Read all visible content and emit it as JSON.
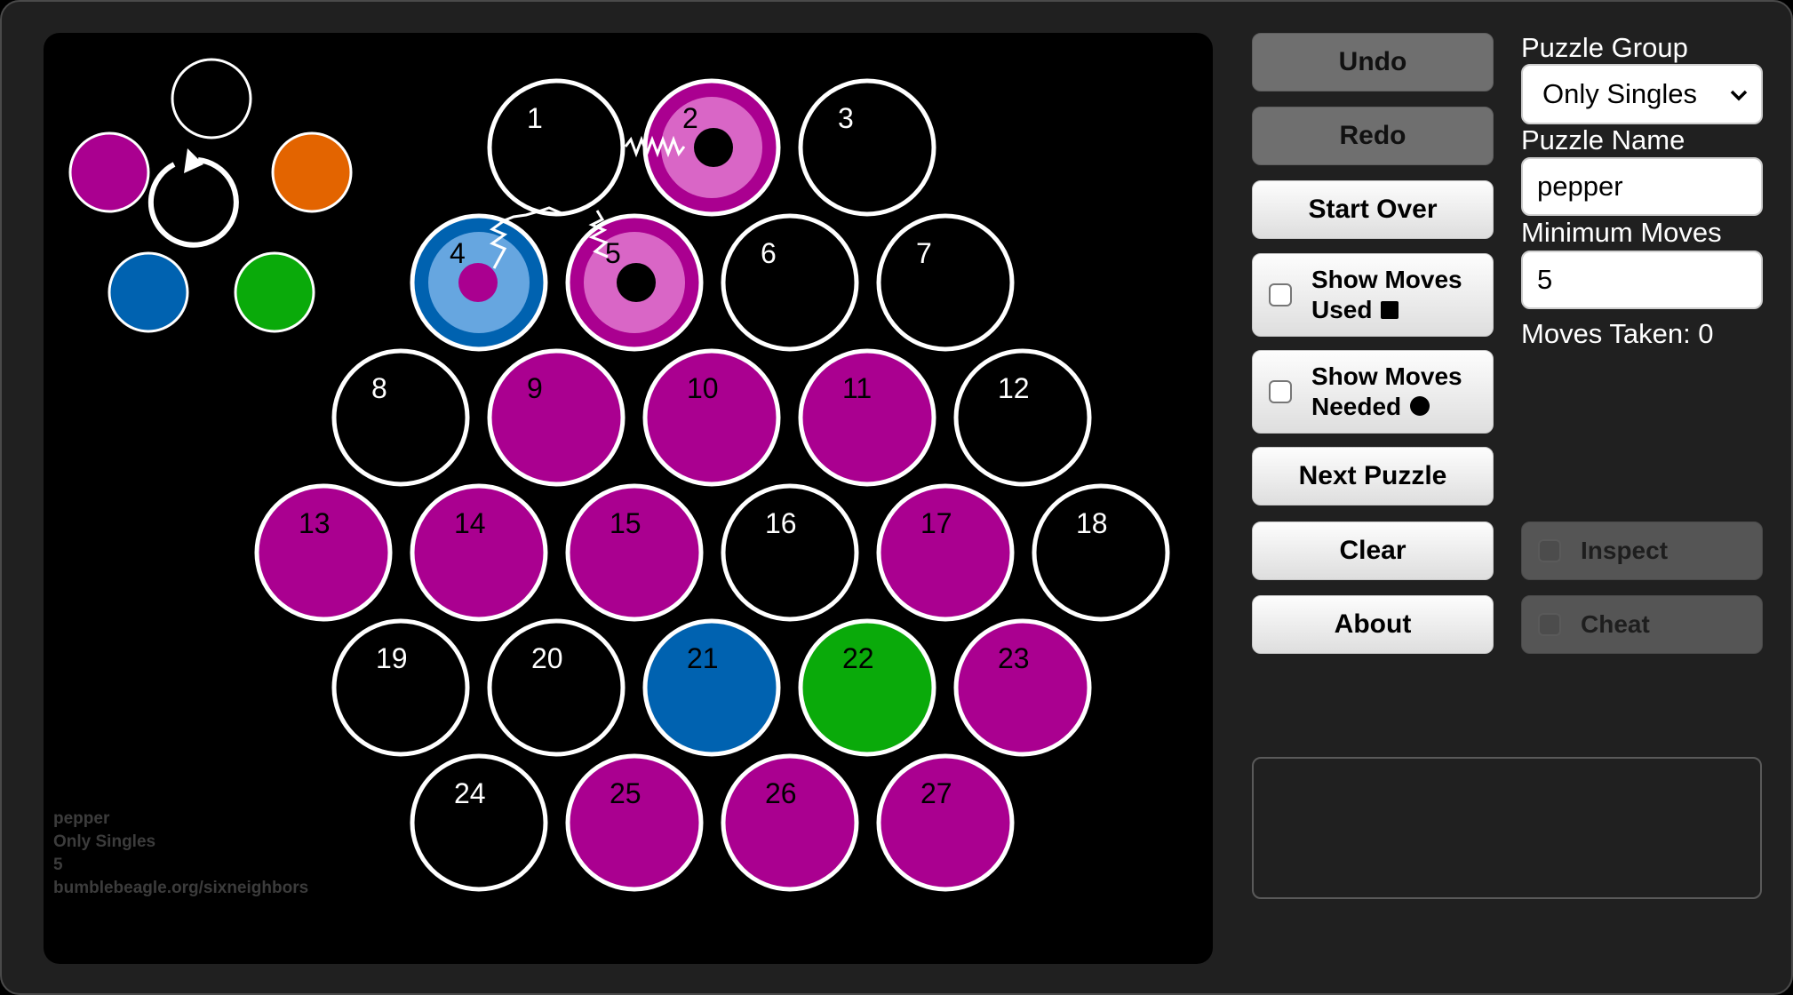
{
  "board": {
    "cells": [
      {
        "n": "1",
        "fill": "#000000",
        "state": "empty"
      },
      {
        "n": "2",
        "fill": "#d966c6",
        "state": "selected-target"
      },
      {
        "n": "3",
        "fill": "#000000",
        "state": "empty"
      },
      {
        "n": "4",
        "fill": "#66a6e0",
        "state": "selected-source"
      },
      {
        "n": "5",
        "fill": "#d966c6",
        "state": "selected-target"
      },
      {
        "n": "6",
        "fill": "#000000",
        "state": "empty"
      },
      {
        "n": "7",
        "fill": "#000000",
        "state": "empty"
      },
      {
        "n": "8",
        "fill": "#000000",
        "state": "empty"
      },
      {
        "n": "9",
        "fill": "#aa0090",
        "state": "magenta"
      },
      {
        "n": "10",
        "fill": "#aa0090",
        "state": "magenta"
      },
      {
        "n": "11",
        "fill": "#aa0090",
        "state": "magenta"
      },
      {
        "n": "12",
        "fill": "#000000",
        "state": "empty"
      },
      {
        "n": "13",
        "fill": "#aa0090",
        "state": "magenta"
      },
      {
        "n": "14",
        "fill": "#aa0090",
        "state": "magenta"
      },
      {
        "n": "15",
        "fill": "#aa0090",
        "state": "magenta"
      },
      {
        "n": "16",
        "fill": "#000000",
        "state": "empty"
      },
      {
        "n": "17",
        "fill": "#aa0090",
        "state": "magenta"
      },
      {
        "n": "18",
        "fill": "#000000",
        "state": "empty"
      },
      {
        "n": "19",
        "fill": "#000000",
        "state": "empty"
      },
      {
        "n": "20",
        "fill": "#000000",
        "state": "empty"
      },
      {
        "n": "21",
        "fill": "#0062b0",
        "state": "blue"
      },
      {
        "n": "22",
        "fill": "#0aaa0a",
        "state": "green"
      },
      {
        "n": "23",
        "fill": "#aa0090",
        "state": "magenta"
      },
      {
        "n": "24",
        "fill": "#000000",
        "state": "empty"
      },
      {
        "n": "25",
        "fill": "#aa0090",
        "state": "magenta"
      },
      {
        "n": "26",
        "fill": "#aa0090",
        "state": "magenta"
      },
      {
        "n": "27",
        "fill": "#aa0090",
        "state": "magenta"
      }
    ],
    "palette": [
      {
        "name": "empty",
        "color": "#000000"
      },
      {
        "name": "orange",
        "color": "#e36400"
      },
      {
        "name": "green",
        "color": "#0aaa0a"
      },
      {
        "name": "blue",
        "color": "#0062b0"
      },
      {
        "name": "magenta",
        "color": "#aa0090"
      }
    ],
    "cycle_icon": "rotate-clockwise-icon",
    "footer": {
      "name": "pepper",
      "group": "Only Singles",
      "min_moves": "5",
      "url": "bumblebeagle.org/sixneighbors"
    }
  },
  "controls": {
    "undo": "Undo",
    "redo": "Redo",
    "start_over": "Start Over",
    "show_moves_used": "Show Moves Used",
    "show_moves_used_l1": "Show Moves",
    "show_moves_used_l2": "Used",
    "show_moves_needed": "Show Moves Needed",
    "show_moves_needed_l1": "Show Moves",
    "show_moves_needed_l2": "Needed",
    "next_puzzle": "Next Puzzle",
    "clear": "Clear",
    "about": "About",
    "inspect": "Inspect",
    "cheat": "Cheat"
  },
  "panel": {
    "puzzle_group_label": "Puzzle Group",
    "puzzle_group_value": "Only Singles",
    "puzzle_name_label": "Puzzle Name",
    "puzzle_name_value": "pepper",
    "min_moves_label": "Minimum Moves",
    "min_moves_value": "5",
    "moves_taken": "Moves Taken: 0",
    "message": ""
  },
  "colors": {
    "background": "#202020",
    "board": "#000000",
    "magenta": "#aa0090",
    "light_magenta": "#d966c6",
    "blue": "#0062b0",
    "light_blue": "#66a6e0",
    "green": "#0aaa0a",
    "orange": "#e36400"
  }
}
